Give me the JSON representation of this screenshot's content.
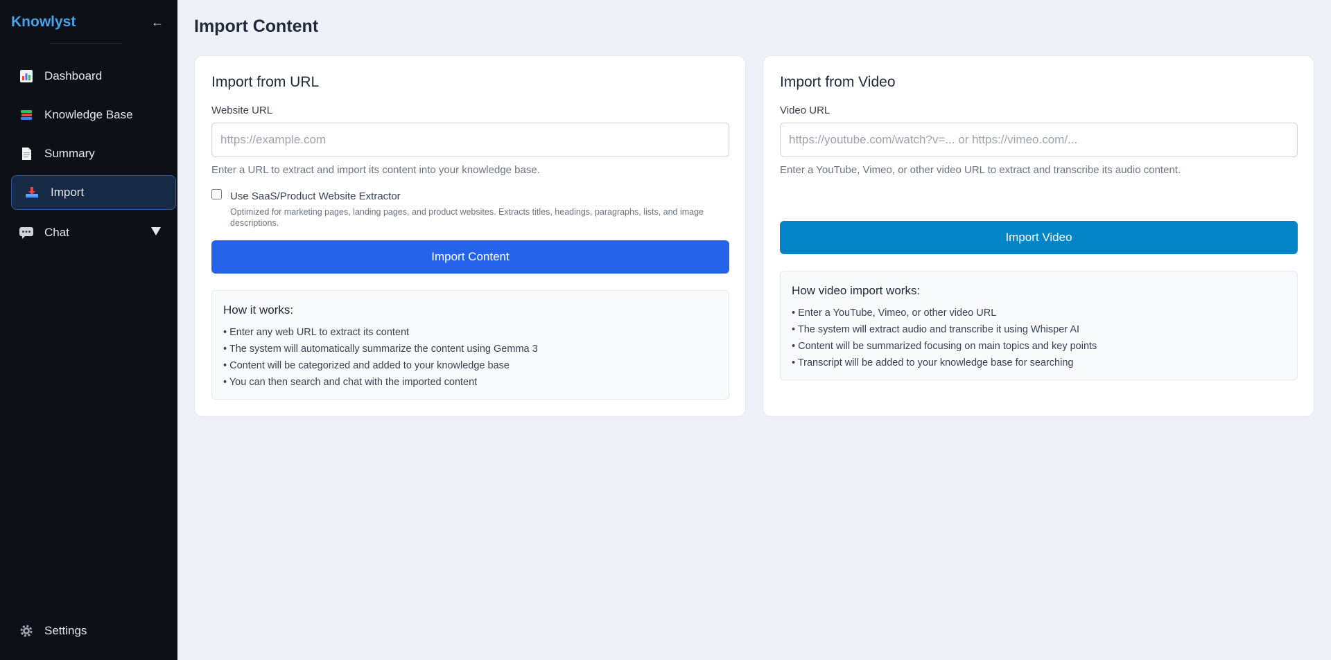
{
  "app": {
    "brand": "Knowlyst",
    "collapse_icon": "←"
  },
  "sidebar": {
    "items": [
      {
        "label": "Dashboard",
        "icon": "bar-chart-icon"
      },
      {
        "label": "Knowledge Base",
        "icon": "books-icon"
      },
      {
        "label": "Summary",
        "icon": "document-icon"
      },
      {
        "label": "Import",
        "icon": "inbox-tray-icon",
        "active": true
      },
      {
        "label": "Chat",
        "icon": "speech-bubble-icon",
        "expandable": true
      }
    ],
    "settings": {
      "label": "Settings",
      "icon": "gear-icon"
    }
  },
  "main": {
    "title": "Import Content",
    "url_card": {
      "title": "Import from URL",
      "field_label": "Website URL",
      "placeholder": "https://example.com",
      "value": "",
      "help": "Enter a URL to extract and import its content into your knowledge base.",
      "checkbox_label": "Use SaaS/Product Website Extractor",
      "checkbox_checked": false,
      "checkbox_desc": "Optimized for marketing pages, landing pages, and product websites. Extracts titles, headings, paragraphs, lists, and image descriptions.",
      "button": "Import Content",
      "info_title": "How it works:",
      "info_items": [
        "Enter any web URL to extract its content",
        "The system will automatically summarize the content using Gemma 3",
        "Content will be categorized and added to your knowledge base",
        "You can then search and chat with the imported content"
      ]
    },
    "video_card": {
      "title": "Import from Video",
      "field_label": "Video URL",
      "placeholder": "https://youtube.com/watch?v=... or https://vimeo.com/...",
      "value": "",
      "help": "Enter a YouTube, Vimeo, or other video URL to extract and transcribe its audio content.",
      "button": "Import Video",
      "info_title": "How video import works:",
      "info_items": [
        "Enter a YouTube, Vimeo, or other video URL",
        "The system will extract audio and transcribe it using Whisper AI",
        "Content will be summarized focusing on main topics and key points",
        "Transcript will be added to your knowledge base for searching"
      ]
    }
  },
  "colors": {
    "sidebar_bg": "#0d1117",
    "brand": "#4aa3e8",
    "primary_button": "#2563eb",
    "video_button": "#0284c7",
    "active_nav_bg": "#172a45"
  }
}
